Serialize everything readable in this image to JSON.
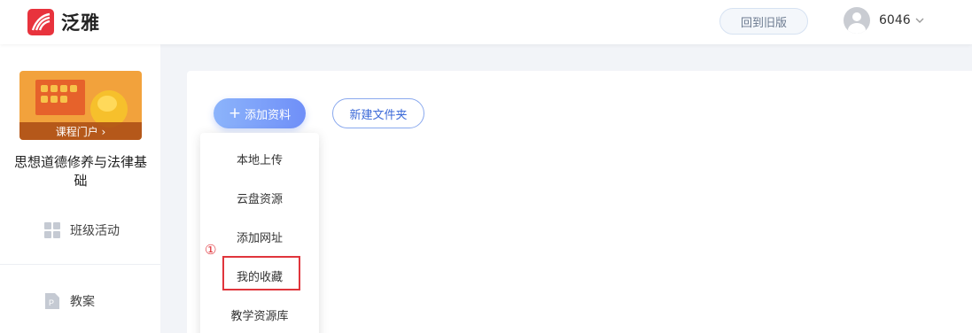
{
  "header": {
    "brand": "泛雅",
    "back_to_old_label": "回到旧版",
    "username": "6046"
  },
  "sidebar": {
    "cover_label": "课程门户 ›",
    "course_title": "思想道德修养与法律基础",
    "items": [
      {
        "label": "班级活动",
        "icon": "grid-icon"
      },
      {
        "label": "教案",
        "icon": "document-icon"
      }
    ]
  },
  "toolbar": {
    "add_material_label": "添加资料",
    "new_folder_label": "新建文件夹"
  },
  "add_menu": {
    "items": [
      "本地上传",
      "云盘资源",
      "添加网址",
      "我的收藏",
      "教学资源库"
    ],
    "highlighted_item": "我的收藏"
  },
  "annotation": {
    "marker": "①",
    "color": "#e0353c"
  },
  "colors": {
    "brand": "#e8333d",
    "primary": "#6f8ff8"
  }
}
